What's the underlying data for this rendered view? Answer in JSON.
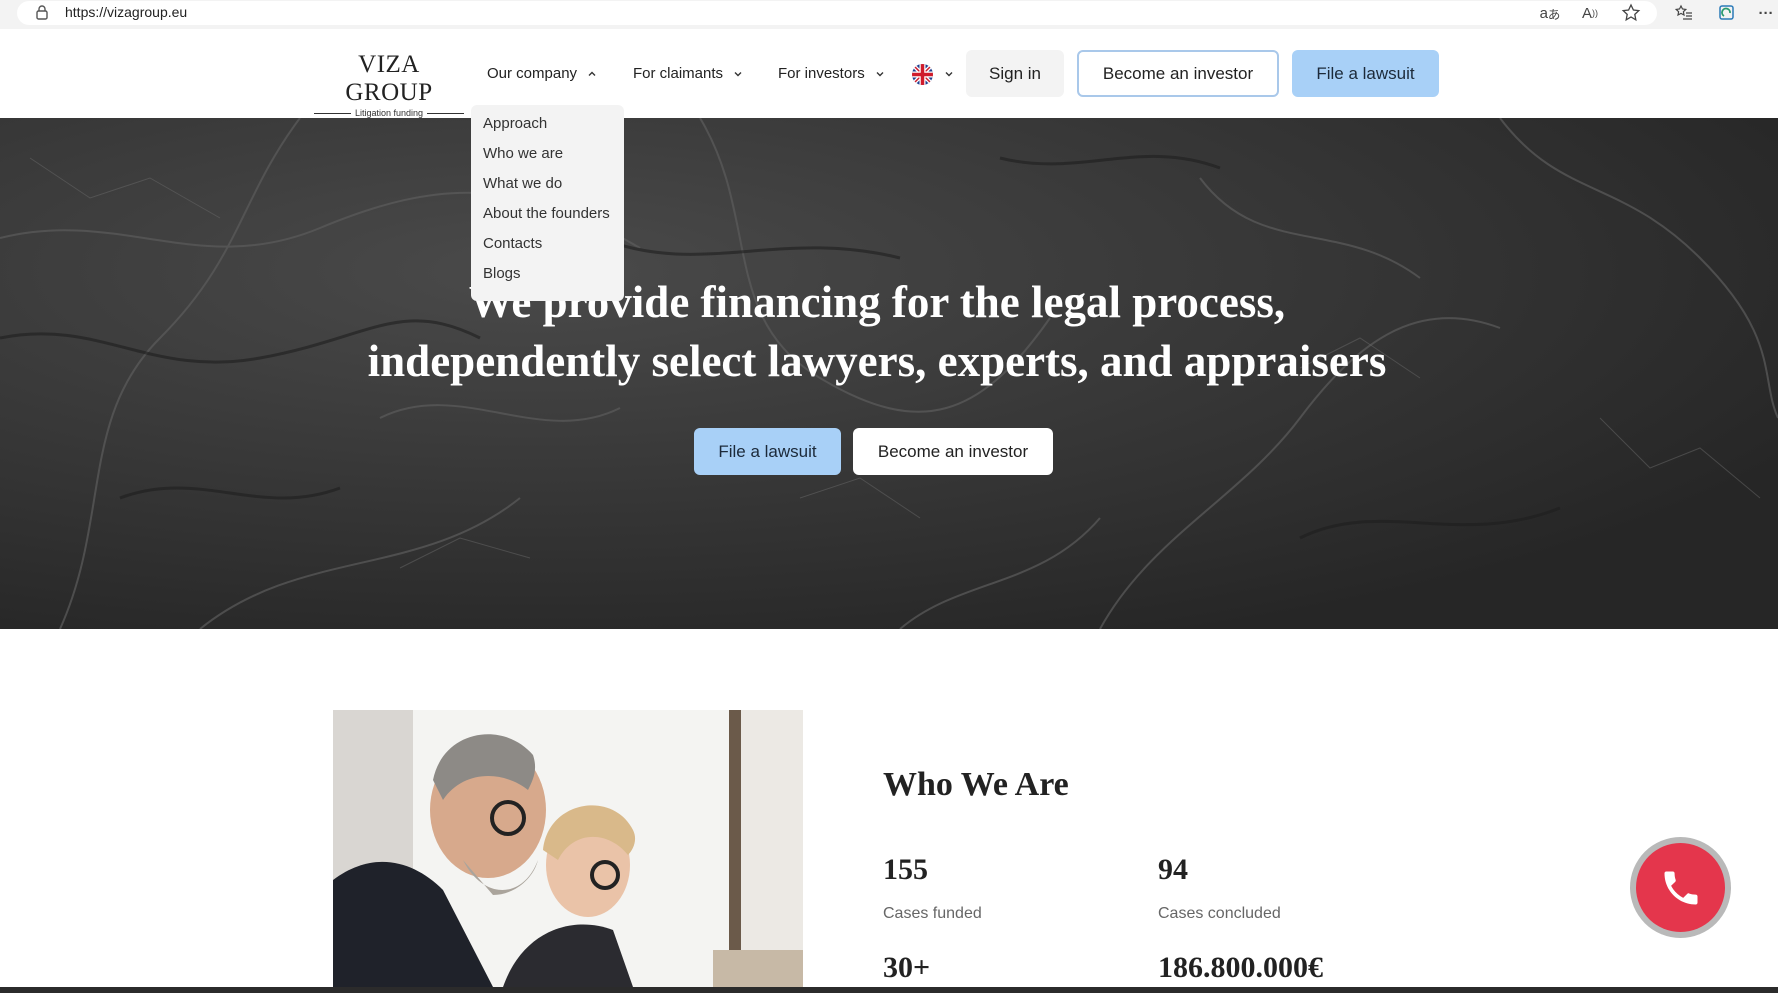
{
  "browser": {
    "url": "https://vizagroup.eu",
    "icons": [
      "lock-icon",
      "translate-icon",
      "read-aloud-icon",
      "favorite-star-icon",
      "favorites-list-icon",
      "collections-icon",
      "more-icon"
    ]
  },
  "header": {
    "logo_main": "VIZA GROUP",
    "logo_sub": "Litigation funding",
    "nav": [
      {
        "label": "Our company",
        "expanded": true
      },
      {
        "label": "For claimants",
        "expanded": false
      },
      {
        "label": "For investors",
        "expanded": false
      }
    ],
    "language_flag": "uk-flag-icon",
    "sign_in": "Sign in",
    "become_investor": "Become an investor",
    "file_lawsuit": "File a lawsuit"
  },
  "dropdown": {
    "items": [
      "Approach",
      "Who we are",
      "What we do",
      "About the founders",
      "Contacts",
      "Blogs"
    ]
  },
  "hero": {
    "title_line1": "We provide financing for the legal process,",
    "title_line2": "independently select lawyers, experts, and appraisers",
    "file_lawsuit": "File a lawsuit",
    "become_investor": "Become an investor"
  },
  "who": {
    "title": "Who We Are",
    "stats": [
      {
        "value": "155",
        "label": "Cases funded"
      },
      {
        "value": "94",
        "label": "Cases concluded"
      },
      {
        "value": "30+",
        "label": ""
      },
      {
        "value": "186.800.000€",
        "label": ""
      }
    ]
  },
  "colors": {
    "accent_blue": "#a8d0f7",
    "call_red": "#e4364c",
    "hero_dark": "#2e2e2e"
  }
}
